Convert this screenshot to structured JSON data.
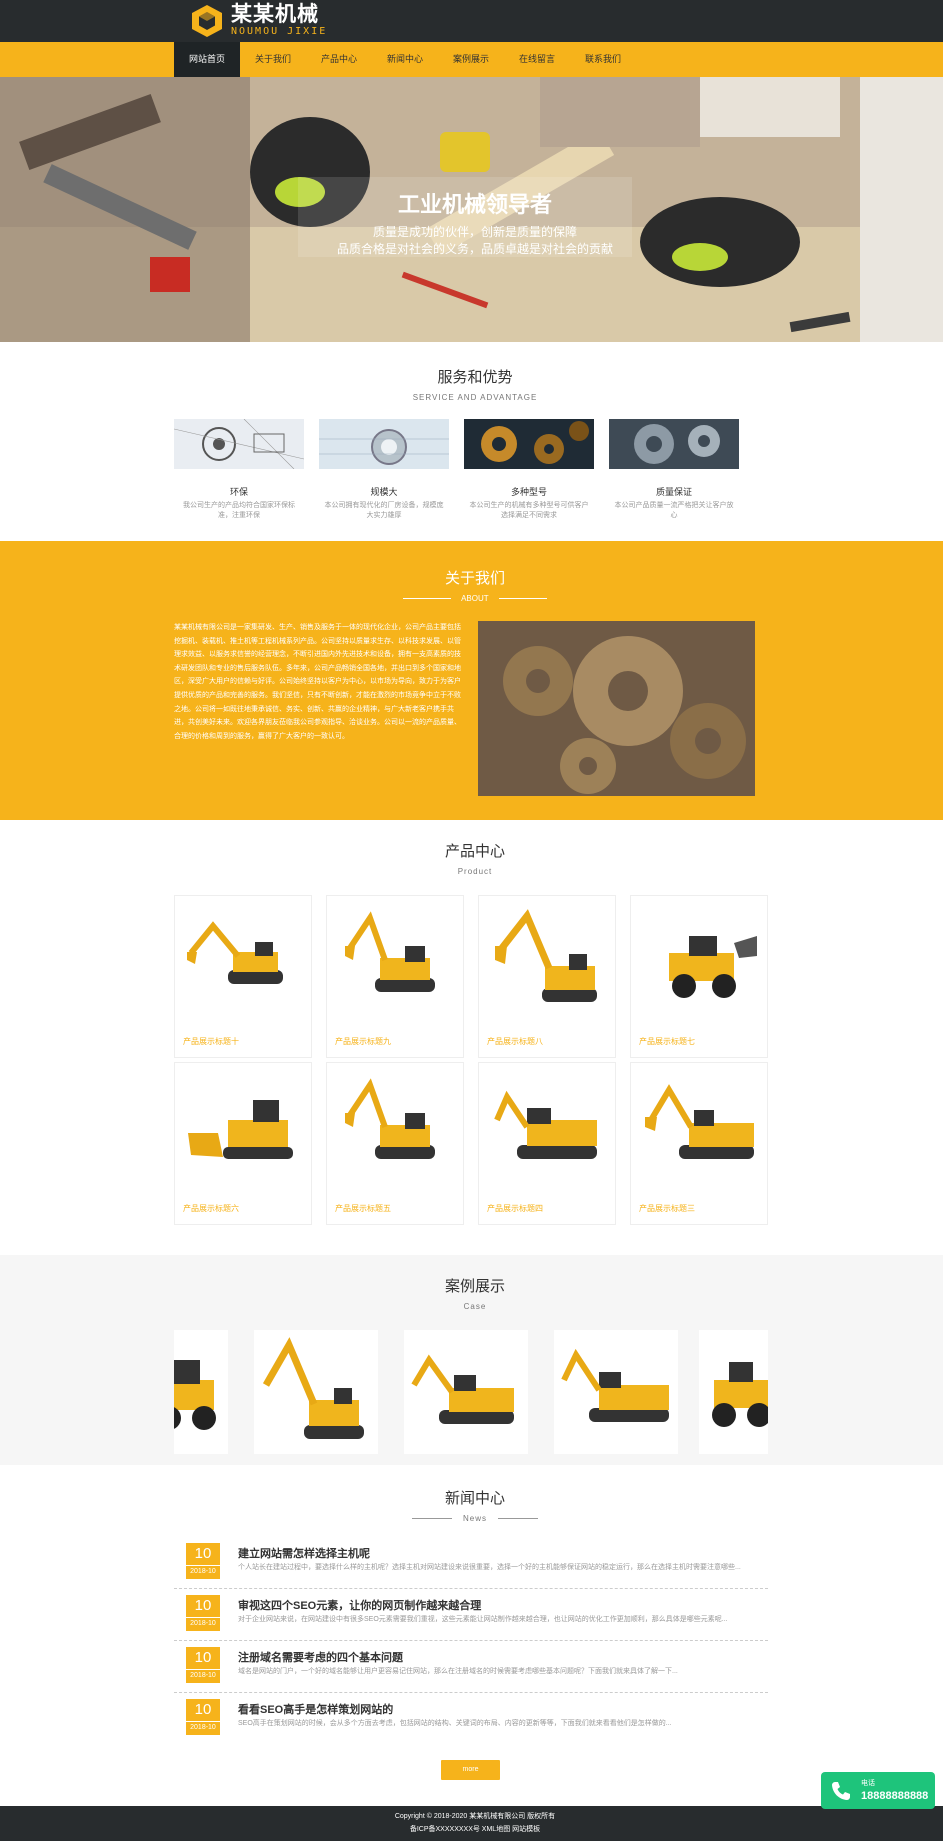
{
  "brand": {
    "title": "某某机械",
    "subtitle": "NOUMOU JIXIE",
    "accent": "#f6b31b",
    "dark": "#282c2e"
  },
  "nav": {
    "items": [
      "网站首页",
      "关于我们",
      "产品中心",
      "新闻中心",
      "案例展示",
      "在线留言",
      "联系我们"
    ]
  },
  "banner": {
    "title": "工业机械领导者",
    "line1": "质量是成功的伙伴，创新是质量的保障",
    "line2": "品质合格是对社会的义务，品质卓越是对社会的贡献"
  },
  "services": {
    "title": "服务和优势",
    "subtitle": "SERVICE AND ADVANTAGE",
    "items": [
      {
        "name": "环保",
        "desc": "我公司生产的产品均符合国家环保标准，注重环保"
      },
      {
        "name": "规模大",
        "desc": "本公司拥有现代化的厂房设备，规模庞大实力雄厚"
      },
      {
        "name": "多种型号",
        "desc": "本公司生产的机械有多种型号可供客户选择满足不同需求"
      },
      {
        "name": "质量保证",
        "desc": "本公司产品质量一流严格把关让客户放心"
      }
    ]
  },
  "about": {
    "title": "关于我们",
    "subtitle": "ABOUT",
    "text": "某某机械有限公司是一家集研发、生产、销售及服务于一体的现代化企业，公司产品主要包括挖掘机、装载机、推土机等工程机械系列产品。公司坚持以质量求生存、以科技求发展、以管理求效益、以服务求信誉的经营理念，不断引进国内外先进技术和设备，拥有一支高素质的技术研发团队和专业的售后服务队伍。多年来，公司产品畅销全国各地，并出口到多个国家和地区，深受广大用户的信赖与好评。公司始终坚持以客户为中心，以市场为导向，致力于为客户提供优质的产品和完善的服务。我们坚信，只有不断创新，才能在激烈的市场竞争中立于不败之地。公司将一如既往地秉承诚信、务实、创新、共赢的企业精神，与广大新老客户携手共进，共创美好未来。欢迎各界朋友莅临我公司参观指导、洽谈业务。公司以一流的产品质量、合理的价格和周到的服务，赢得了广大客户的一致认可。"
  },
  "products": {
    "title": "产品中心",
    "subtitle": "Product",
    "items": [
      {
        "name": "产品展示标题十"
      },
      {
        "name": "产品展示标题九"
      },
      {
        "name": "产品展示标题八"
      },
      {
        "name": "产品展示标题七"
      },
      {
        "name": "产品展示标题六"
      },
      {
        "name": "产品展示标题五"
      },
      {
        "name": "产品展示标题四"
      },
      {
        "name": "产品展示标题三"
      }
    ]
  },
  "cases": {
    "title": "案例展示",
    "subtitle": "Case"
  },
  "news": {
    "title": "新闻中心",
    "subtitle": "News",
    "items": [
      {
        "day": "10",
        "ym": "2018-10",
        "title": "建立网站需怎样选择主机呢",
        "desc": "个人站长在建站过程中，要选择什么样的主机呢？选择主机对网站建设来说很重要，选择一个好的主机能够保证网站的稳定运行，那么在选择主机时需要注意哪些..."
      },
      {
        "day": "10",
        "ym": "2018-10",
        "title": "审视这四个SEO元素，让你的网页制作越来越合理",
        "desc": "对于企业网站来说，在网站建设中有很多SEO元素需要我们重视，这些元素能让网站制作越来越合理，也让网站的优化工作更加顺利，那么具体是哪些元素呢..."
      },
      {
        "day": "10",
        "ym": "2018-10",
        "title": "注册域名需要考虑的四个基本问题",
        "desc": "域名是网站的门户，一个好的域名能够让用户更容易记住网站，那么在注册域名的时候需要考虑哪些基本问题呢？下面我们就来具体了解一下..."
      },
      {
        "day": "10",
        "ym": "2018-10",
        "title": "看看SEO高手是怎样策划网站的",
        "desc": "SEO高手在策划网站的时候，会从多个方面去考虑，包括网站的结构、关键词的布局、内容的更新等等，下面我们就来看看他们是怎样做的..."
      }
    ],
    "more": "more"
  },
  "footer": {
    "copyright": "Copyright © 2018-2020 某某机械有限公司 版权所有",
    "icp": "备ICP备XXXXXXXX号 XML地图 网站模板"
  },
  "phone": {
    "label": "电话",
    "number": "18888888888"
  }
}
